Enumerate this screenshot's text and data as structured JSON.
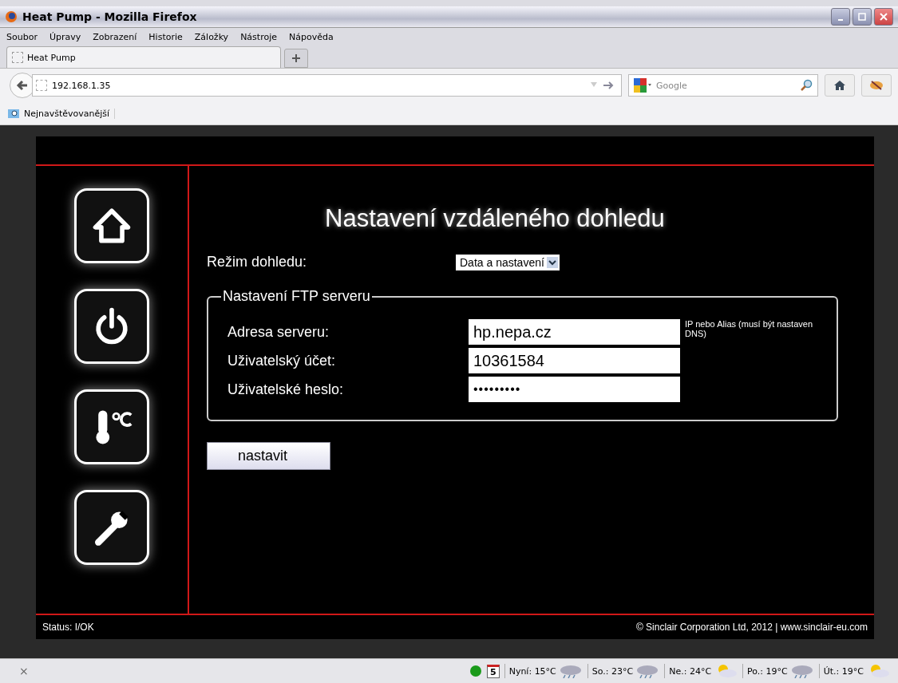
{
  "window": {
    "title": "Heat Pump - Mozilla Firefox"
  },
  "menu": [
    "Soubor",
    "Úpravy",
    "Zobrazení",
    "Historie",
    "Záložky",
    "Nástroje",
    "Nápověda"
  ],
  "tabs": [
    {
      "label": "Heat Pump",
      "selected": true
    }
  ],
  "address_bar": {
    "value": "192.168.1.35"
  },
  "search": {
    "placeholder": "Google"
  },
  "bookmarks": [
    "Nejnavštěvovanější"
  ],
  "page": {
    "nav": [
      {
        "kind": "home"
      },
      {
        "kind": "power"
      },
      {
        "kind": "temperature"
      },
      {
        "kind": "settings"
      }
    ],
    "heading": "Nastavení vzdáleného dohledu",
    "mode": {
      "label": "Režim dohledu:",
      "value": "Data a nastavení"
    },
    "ftp": {
      "legend": "Nastavení FTP serveru",
      "fields": [
        {
          "label": "Adresa serveru:",
          "value": "hp.nepa.cz",
          "hint": "IP nebo Alias (musí být nastaven DNS)"
        },
        {
          "label": "Uživatelský účet:",
          "value": "10361584"
        },
        {
          "label": "Uživatelské heslo:",
          "value": "•••••••••"
        }
      ]
    },
    "submit": "nastavit",
    "status": "Status: I/OK",
    "footer": "© Sinclair Corporation Ltd, 2012 | www.sinclair-eu.com"
  },
  "status_bar": {
    "close": "×",
    "calendar": "5",
    "weather": [
      {
        "text": "Nyní: 15°C",
        "kind": "rain"
      },
      {
        "text": "So.: 23°C",
        "kind": "rain"
      },
      {
        "text": "Ne.: 24°C",
        "kind": "sun"
      },
      {
        "text": "Po.: 19°C",
        "kind": "rain"
      },
      {
        "text": "Út.: 19°C",
        "kind": "sun"
      }
    ]
  }
}
